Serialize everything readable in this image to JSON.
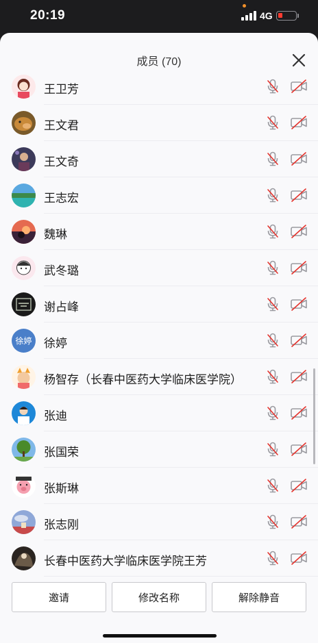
{
  "status_bar": {
    "time": "20:19",
    "network": "4G",
    "battery_level": 0.15,
    "battery_color": "#ff3b30",
    "notification_dot_color": "#f0902a"
  },
  "header": {
    "title": "成员 (70)",
    "close_icon": "close-icon"
  },
  "members": [
    {
      "name": "王卫芳",
      "avatar": "cartoon-girl-avatar",
      "mic": "muted",
      "camera": "off"
    },
    {
      "name": "王文君",
      "avatar": "dog-photo-avatar",
      "mic": "muted",
      "camera": "off"
    },
    {
      "name": "王文奇",
      "avatar": "portrait-photo-avatar",
      "mic": "muted",
      "camera": "off"
    },
    {
      "name": "王志宏",
      "avatar": "landscape-photo-avatar",
      "mic": "muted",
      "camera": "off"
    },
    {
      "name": "魏琳",
      "avatar": "sunset-photo-avatar",
      "mic": "muted",
      "camera": "off"
    },
    {
      "name": "武冬璐",
      "avatar": "sketch-girl-avatar",
      "mic": "muted",
      "camera": "off"
    },
    {
      "name": "谢占峰",
      "avatar": "dark-calligraphy-avatar",
      "mic": "muted",
      "camera": "off"
    },
    {
      "name": "徐婷",
      "avatar": "initials-avatar",
      "avatar_text": "徐婷",
      "mic": "muted",
      "camera": "off"
    },
    {
      "name": "杨智存（长春中医药大学临床医学院）",
      "avatar": "cartoon-character-avatar",
      "mic": "muted",
      "camera": "off"
    },
    {
      "name": "张迪",
      "avatar": "person-photo-avatar",
      "mic": "muted",
      "camera": "off"
    },
    {
      "name": "张国荣",
      "avatar": "tree-photo-avatar",
      "mic": "muted",
      "camera": "off"
    },
    {
      "name": "张斯琳",
      "avatar": "cartoon-pig-avatar",
      "mic": "muted",
      "camera": "off"
    },
    {
      "name": "张志刚",
      "avatar": "sky-photo-avatar",
      "mic": "muted",
      "camera": "off"
    },
    {
      "name": "长春中医药大学临床医学院王芳",
      "avatar": "dark-photo-avatar",
      "mic": "muted",
      "camera": "off"
    }
  ],
  "actions": {
    "invite": "邀请",
    "rename": "修改名称",
    "unmute": "解除静音"
  },
  "colors": {
    "muted_red": "#e5342e",
    "icon_gray": "#9a9aa0"
  }
}
